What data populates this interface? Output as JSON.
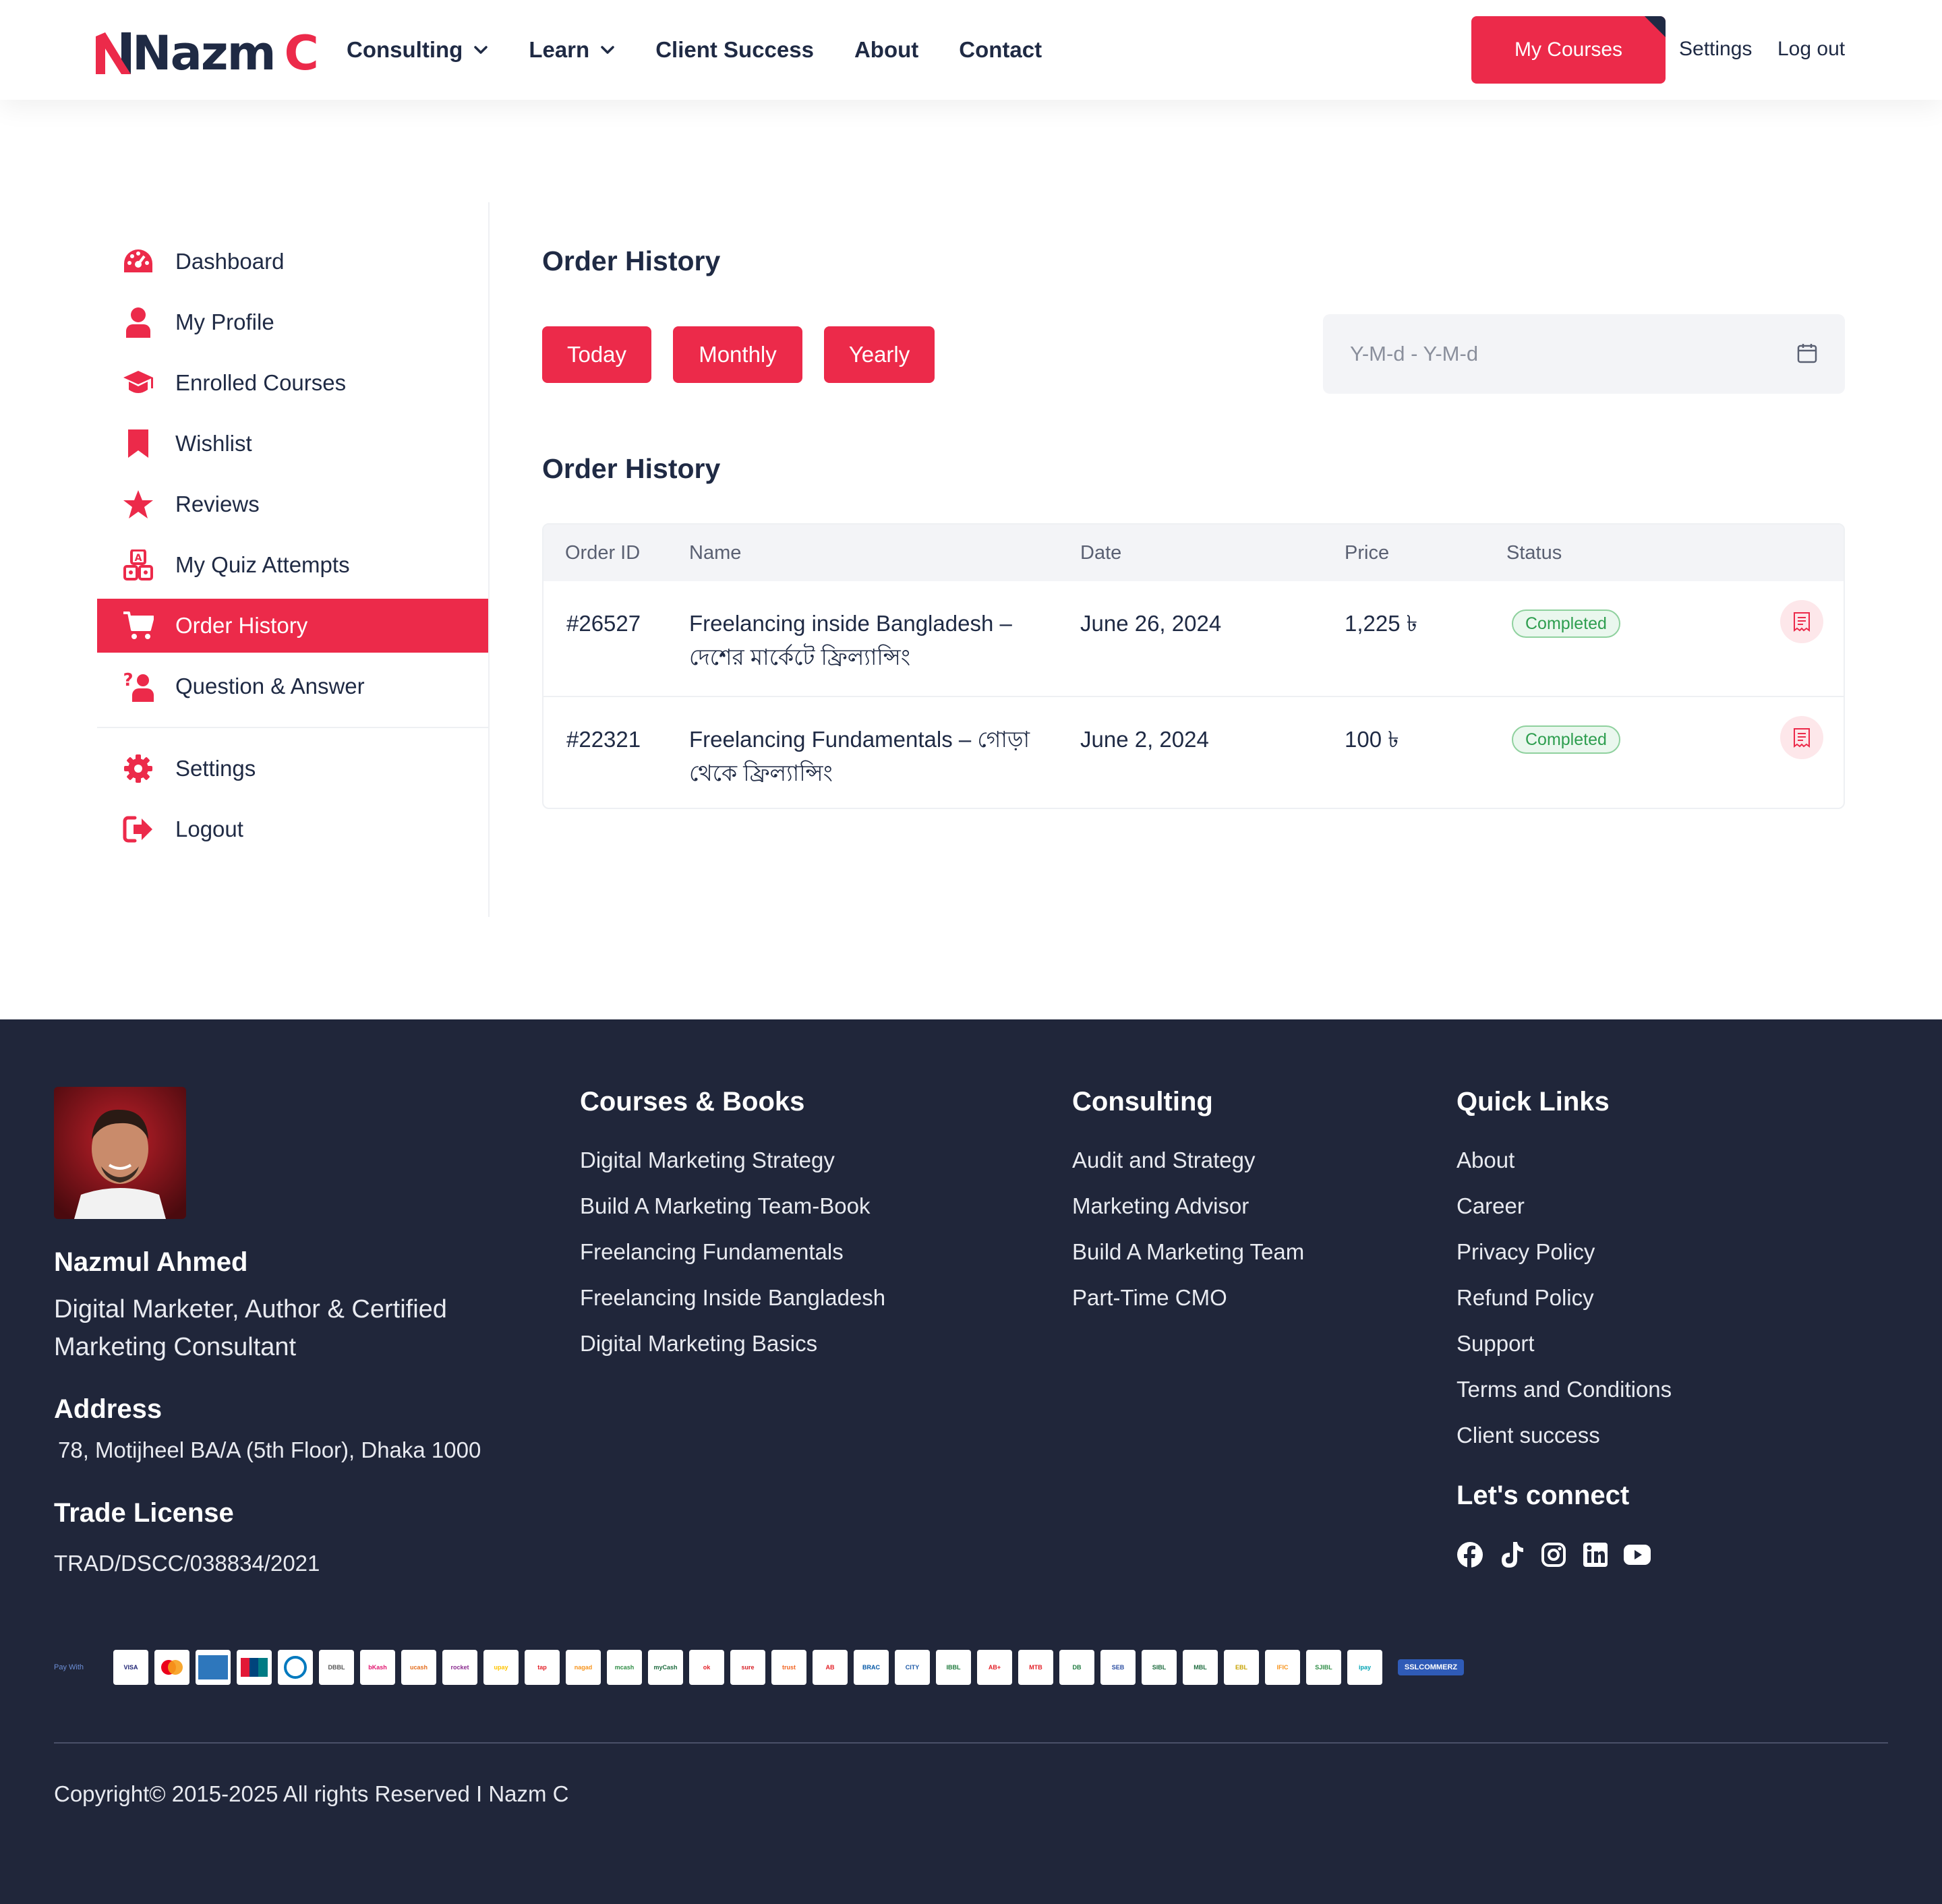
{
  "brand": {
    "logo_text": "Nazm",
    "logo_accent": "C",
    "accent_color": "#ec2a4a",
    "dark_color": "#1f2a44",
    "footer_bg": "#20263a"
  },
  "header": {
    "nav": [
      {
        "label": "Consulting",
        "dropdown": true
      },
      {
        "label": "Learn",
        "dropdown": true
      },
      {
        "label": "Client Success",
        "dropdown": false
      },
      {
        "label": "About",
        "dropdown": false
      },
      {
        "label": "Contact",
        "dropdown": false
      }
    ],
    "my_courses_label": "My Courses",
    "settings_label": "Settings",
    "logout_label": "Log out"
  },
  "sidebar": {
    "items": [
      {
        "label": "Dashboard",
        "icon": "dashboard-icon"
      },
      {
        "label": "My Profile",
        "icon": "user-icon"
      },
      {
        "label": "Enrolled Courses",
        "icon": "graduation-cap-icon"
      },
      {
        "label": "Wishlist",
        "icon": "bookmark-icon"
      },
      {
        "label": "Reviews",
        "icon": "star-icon"
      },
      {
        "label": "My Quiz Attempts",
        "icon": "quiz-icon"
      },
      {
        "label": "Order History",
        "icon": "cart-icon",
        "active": true
      },
      {
        "label": "Question & Answer",
        "icon": "question-answer-icon"
      },
      {
        "label": "Settings",
        "icon": "gear-icon"
      },
      {
        "label": "Logout",
        "icon": "logout-icon"
      }
    ]
  },
  "main": {
    "page_title": "Order History",
    "filters": [
      "Today",
      "Monthly",
      "Yearly"
    ],
    "date_range_placeholder": "Y-M-d - Y-M-d",
    "table_title": "Order History",
    "columns": [
      "Order ID",
      "Name",
      "Date",
      "Price",
      "Status"
    ],
    "orders": [
      {
        "id": "#26527",
        "name_line1": "Freelancing inside Bangladesh –",
        "name_line2": "দেশের মার্কেটে ফ্রিল্যান্সিং",
        "date": "June 26, 2024",
        "price": "1,225 ৳",
        "status": "Completed"
      },
      {
        "id": "#22321",
        "name_line1": "Freelancing Fundamentals – গোড়া",
        "name_line2": "থেকে ফ্রিল্যান্সিং",
        "date": "June 2, 2024",
        "price": "100 ৳",
        "status": "Completed"
      }
    ]
  },
  "footer": {
    "name": "Nazmul Ahmed",
    "role": "Digital Marketer, Author & Certified Marketing Consultant",
    "address_heading": "Address",
    "address": "78, Motijheel BA/A (5th Floor), Dhaka 1000",
    "license_heading": "Trade License",
    "license": "TRAD/DSCC/038834/2021",
    "columns": [
      {
        "heading": "Courses & Books",
        "links": [
          "Digital Marketing Strategy",
          "Build A Marketing Team-Book",
          "Freelancing Fundamentals",
          "Freelancing Inside Bangladesh",
          "Digital Marketing Basics"
        ]
      },
      {
        "heading": "Consulting",
        "links": [
          "Audit and Strategy",
          "Marketing Advisor",
          "Build A Marketing Team",
          "Part-Time CMO"
        ]
      },
      {
        "heading": "Quick Links",
        "links": [
          "About",
          "Career",
          "Privacy Policy",
          "Refund Policy",
          "Support",
          "Terms and Conditions",
          "Client success"
        ]
      }
    ],
    "connect_heading": "Let's connect",
    "social": [
      "facebook-icon",
      "tiktok-icon",
      "instagram-icon",
      "linkedin-icon",
      "youtube-icon"
    ],
    "pay_label": "Pay With",
    "payment_logos": [
      "VISA",
      "mastercard",
      "amex",
      "unionpay",
      "diners",
      "DBBL Nexus",
      "bKash",
      "ucash",
      "rocket",
      "upay",
      "tap",
      "nagad",
      "mcash",
      "mycash",
      "okwallet",
      "sure cash",
      "trust pay",
      "ab pay",
      "brac bank",
      "city bank",
      "islami bank",
      "ab bank",
      "MTB",
      "dhaka bank",
      "southeast bank",
      "mutual trust",
      "eastern bank",
      "ific",
      "dhaka bank 2",
      "shahjalal",
      "ipay"
    ],
    "ssl_label": "SSLCOMMERZ",
    "copyright": "Copyright© 2015-2025 All rights Reserved I Nazm C"
  }
}
